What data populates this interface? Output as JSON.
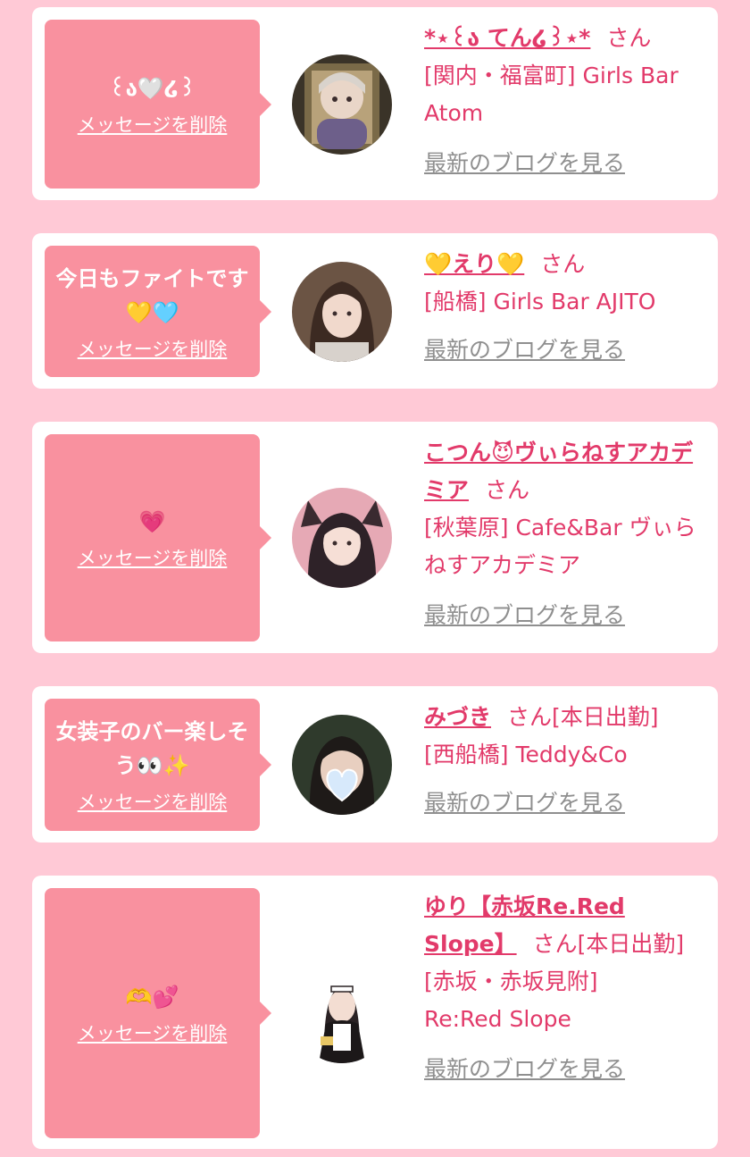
{
  "colors": {
    "page_bg": "#ffc9d6",
    "bubble": "#f9919f",
    "accent": "#e23a6a",
    "muted": "#8f8f8f"
  },
  "items": [
    {
      "message": "꒰ა🤍໒꒱",
      "delete_label": "メッセージを削除",
      "name": "*⋆꒰ა てん໒꒱⋆*",
      "suffix": "さん",
      "extra": "",
      "shop": "[関内・福富町] Girls Bar Atom",
      "blog_label": "最新のブログを見る"
    },
    {
      "message": "今日もファイトです💛🩵",
      "delete_label": "メッセージを削除",
      "name": "💛えり💛",
      "suffix": "さん",
      "extra": "",
      "shop": "[船橋] Girls Bar AJITO",
      "blog_label": "最新のブログを見る"
    },
    {
      "message": "💗",
      "delete_label": "メッセージを削除",
      "name": "こつん😈ヴぃらねすアカデミア",
      "suffix": "さん",
      "extra": "",
      "shop": "[秋葉原] Cafe&Bar ヴぃらねすアカデミア",
      "blog_label": "最新のブログを見る"
    },
    {
      "message": "女装子のバー楽しそう👀✨",
      "delete_label": "メッセージを削除",
      "name": "みづき",
      "suffix": "さん",
      "extra": "[本日出勤]",
      "shop": "[西船橋] Teddy&Co",
      "blog_label": "最新のブログを見る"
    },
    {
      "message": "🫶💕",
      "delete_label": "メッセージを削除",
      "name": "ゆり【赤坂Re.Red Slope】",
      "suffix": "さん",
      "extra": "[本日出勤]",
      "shop": "[赤坂・赤坂見附] Re:Red Slope",
      "blog_label": "最新のブログを見る"
    }
  ]
}
